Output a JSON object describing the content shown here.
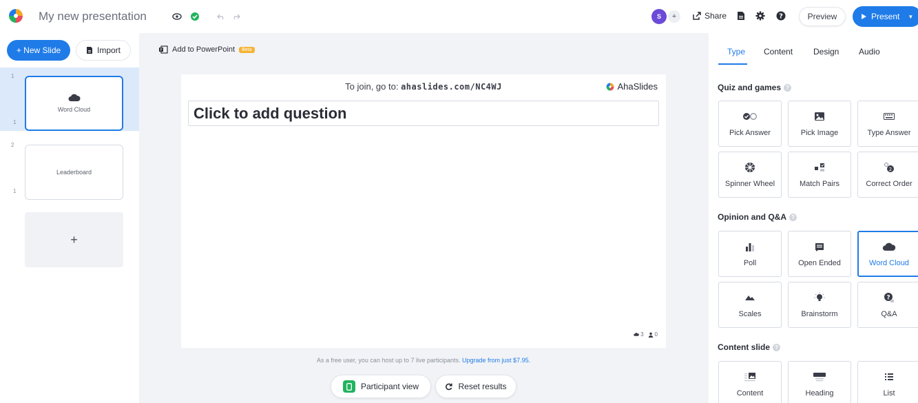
{
  "topbar": {
    "title": "My new presentation",
    "avatar_initial": "S",
    "share_label": "Share",
    "preview_label": "Preview",
    "present_label": "Present"
  },
  "sidebar": {
    "new_slide_label": "+ New Slide",
    "import_label": "Import",
    "slides": [
      {
        "number": "1",
        "title": "Word Cloud",
        "sub": "1"
      },
      {
        "number": "2",
        "title": "Leaderboard",
        "sub": "1"
      }
    ],
    "add_label": "+"
  },
  "toolbar": {
    "pptx_label": "Add to PowerPoint",
    "beta_label": "Beta"
  },
  "canvas": {
    "join_prefix": "To join, go to: ",
    "join_url": "ahaslides.com/NC4WJ",
    "brand": "AhaSlides",
    "question_placeholder": "Click to add question",
    "count_a": "3",
    "count_b": "0"
  },
  "footer": {
    "free_note": "As a free user, you can host up to 7 live participants.",
    "upgrade_link": "Upgrade from just $7.95.",
    "participant_view_label": "Participant view",
    "reset_label": "Reset results"
  },
  "rightpanel": {
    "tabs": [
      "Type",
      "Content",
      "Design",
      "Audio"
    ],
    "sections": [
      {
        "title": "Quiz and games",
        "items": [
          "Pick Answer",
          "Pick Image",
          "Type Answer",
          "Spinner Wheel",
          "Match Pairs",
          "Correct Order"
        ]
      },
      {
        "title": "Opinion and Q&A",
        "items": [
          "Poll",
          "Open Ended",
          "Word Cloud",
          "Scales",
          "Brainstorm",
          "Q&A"
        ]
      },
      {
        "title": "Content slide",
        "items": [
          "Content",
          "Heading",
          "List"
        ]
      }
    ]
  },
  "colors": {
    "accent": "#1f7be8",
    "success": "#22b35e",
    "avatar": "#6b4bd8",
    "beta": "#f5b335"
  }
}
